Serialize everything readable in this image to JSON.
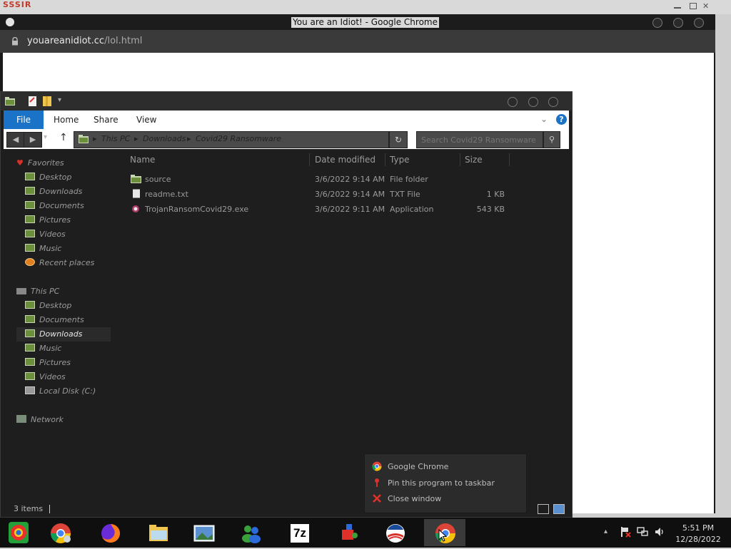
{
  "background_window": {
    "tag": "SSSIR"
  },
  "chrome": {
    "title": "You are an Idiot! - Google Chrome",
    "url_host": "youareanidiot.cc",
    "url_path": "/lol.html"
  },
  "explorer": {
    "tabs": {
      "file": "File",
      "home": "Home",
      "share": "Share",
      "view": "View"
    },
    "breadcrumb": [
      "This PC",
      "Downloads",
      "Covid29 Ransomware"
    ],
    "search_placeholder": "Search Covid29 Ransomware",
    "sidebar": {
      "favorites_header": "Favorites",
      "favorites": [
        "Desktop",
        "Downloads",
        "Documents",
        "Pictures",
        "Videos",
        "Music",
        "Recent places"
      ],
      "thispc_header": "This PC",
      "thispc": [
        "Desktop",
        "Documents",
        "Downloads",
        "Music",
        "Pictures",
        "Videos",
        "Local Disk (C:)"
      ],
      "network_header": "Network"
    },
    "columns": {
      "name": "Name",
      "date": "Date modified",
      "type": "Type",
      "size": "Size"
    },
    "files": [
      {
        "name": "source",
        "date": "3/6/2022 9:14 AM",
        "type": "File folder",
        "size": ""
      },
      {
        "name": "readme.txt",
        "date": "3/6/2022 9:14 AM",
        "type": "TXT File",
        "size": "1 KB"
      },
      {
        "name": "TrojanRansomCovid29.exe",
        "date": "3/6/2022 9:11 AM",
        "type": "Application",
        "size": "543 KB"
      }
    ],
    "status": "3 items"
  },
  "jumplist": {
    "items": [
      "Google Chrome",
      "Pin this program to taskbar",
      "Close window"
    ]
  },
  "taskbar": {
    "time": "5:51 PM",
    "date": "12/28/2022",
    "sevenzip_label": "7z"
  }
}
